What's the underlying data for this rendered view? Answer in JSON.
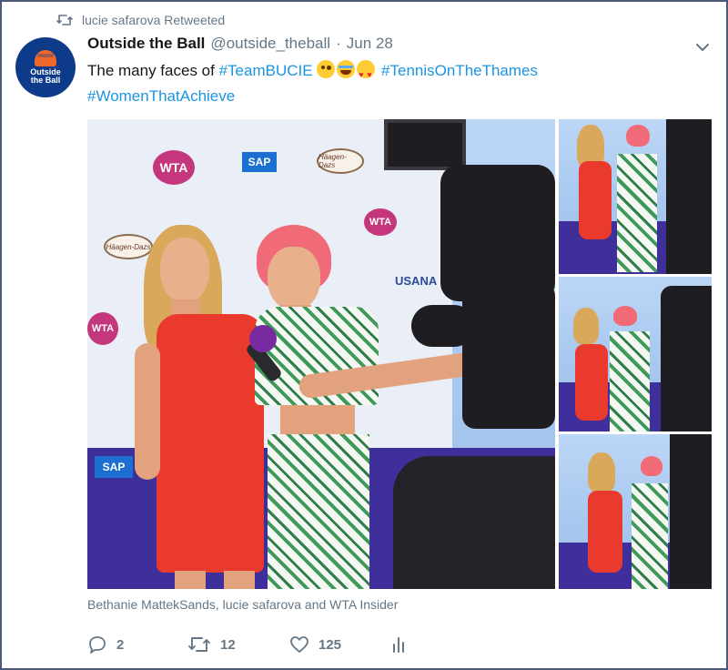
{
  "retweet": {
    "label": "lucie safarova Retweeted"
  },
  "avatar": {
    "logo_text_line1": "Outside",
    "logo_text_line2": "the Ball"
  },
  "tweet": {
    "author_name": "Outside the Ball",
    "author_handle": "@outside_theball",
    "separator": "·",
    "date": "Jun 28",
    "text_prefix": "The many faces of ",
    "hashtag1": "#TeamBUCIE",
    "hashtag2": "#TennisOnTheThames",
    "hashtag3": "#WomenThatAchieve",
    "emojis": [
      "winking-tongue-face",
      "tears-of-joy-face",
      "heart-eyes-face"
    ]
  },
  "media": {
    "main_photo_logos": {
      "wta": "WTA",
      "sap": "SAP",
      "haagen": "Häagen-Dazs",
      "usana": "USANA"
    },
    "caption": "Bethanie MattekSands, lucie safarova and WTA Insider"
  },
  "actions": {
    "reply_count": "2",
    "retweet_count": "12",
    "like_count": "125"
  },
  "colors": {
    "link": "#1b95e0",
    "secondary_text": "#657786",
    "frame_border": "#4a5a78"
  }
}
